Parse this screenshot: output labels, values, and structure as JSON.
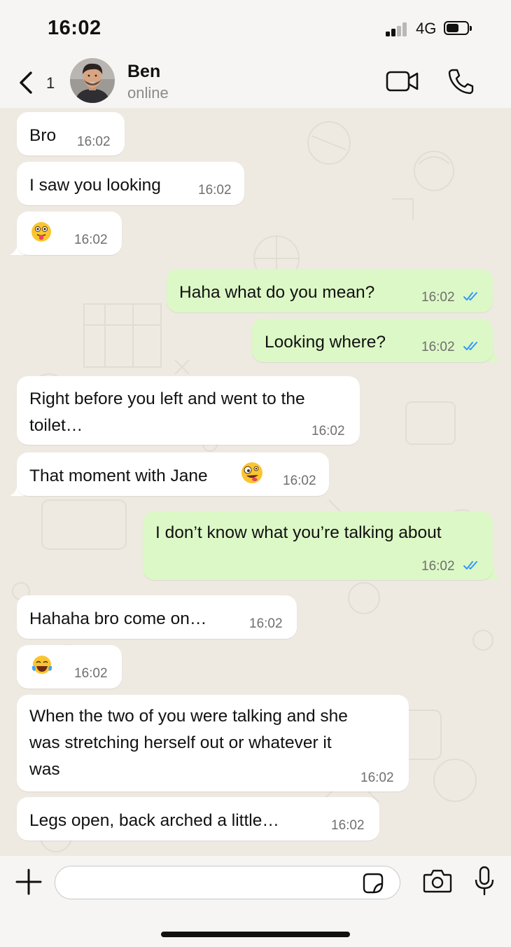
{
  "status_bar": {
    "time": "16:02",
    "network": "4G",
    "icons": [
      "signal-icon",
      "battery-icon"
    ]
  },
  "header": {
    "back_count": "1",
    "contact_name": "Ben",
    "contact_status": "online",
    "icons": [
      "back-chevron-icon",
      "avatar",
      "video-call-icon",
      "phone-call-icon"
    ]
  },
  "messages": [
    {
      "dir": "in",
      "text": "Bro",
      "time": "16:02"
    },
    {
      "dir": "in",
      "text": "I saw you looking",
      "time": "16:02"
    },
    {
      "dir": "in",
      "emoji": "tongue-out-emoji",
      "time": "16:02"
    },
    {
      "dir": "out",
      "text": "Haha what do you mean?",
      "time": "16:02",
      "status": "read"
    },
    {
      "dir": "out",
      "text": "Looking where?",
      "time": "16:02",
      "status": "read"
    },
    {
      "dir": "in",
      "lines": [
        "Right before you left and went to the",
        "toilet…"
      ],
      "time": "16:02"
    },
    {
      "dir": "in",
      "text": "That moment with Jane",
      "emoji": "zany-face-emoji",
      "time": "16:02"
    },
    {
      "dir": "out",
      "text": "I don’t know what you’re talking about",
      "time": "16:02",
      "status": "read"
    },
    {
      "dir": "in",
      "text": "Hahaha bro come on…",
      "time": "16:02"
    },
    {
      "dir": "in",
      "emoji": "tears-of-joy-emoji",
      "time": "16:02"
    },
    {
      "dir": "in",
      "lines": [
        "When the two of you were talking and she",
        "was stretching herself out or whatever it",
        "was"
      ],
      "time": "16:02"
    },
    {
      "dir": "in",
      "text": "Legs open, back arched a little…",
      "time": "16:02"
    }
  ],
  "colors": {
    "incoming": "#ffffff",
    "outgoing": "#dcf8c6",
    "read_ticks": "#3497f9",
    "chat_bg": "#eeeae2"
  },
  "input_bar": {
    "value": "",
    "placeholder": "",
    "icons": [
      "plus-icon",
      "sticker-icon",
      "camera-icon",
      "microphone-icon"
    ]
  }
}
